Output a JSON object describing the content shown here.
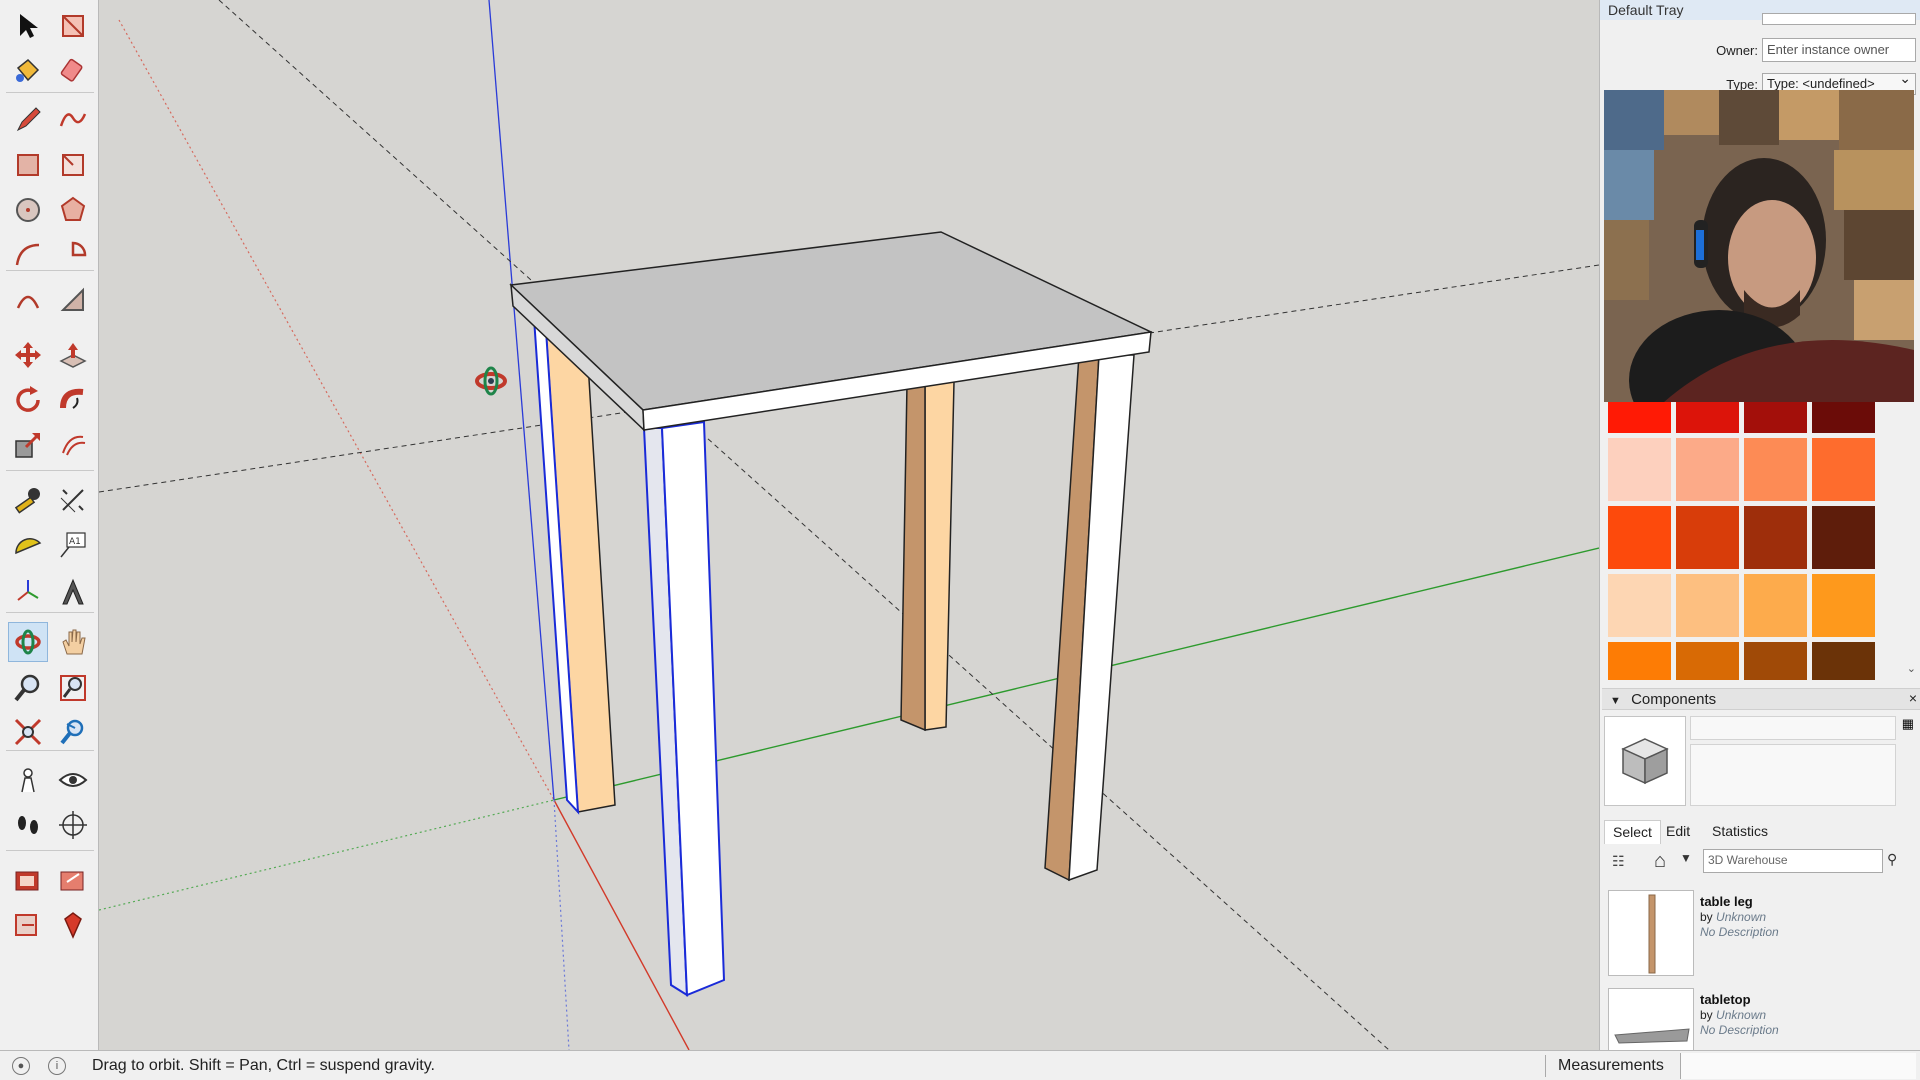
{
  "toolbar": {
    "tools": [
      {
        "name": "select-tool",
        "icon": "arrow-pointer-icon"
      },
      {
        "name": "make-component-tool",
        "icon": "component-box-icon"
      },
      {
        "name": "paint-bucket-tool",
        "icon": "paint-bucket-icon"
      },
      {
        "name": "eraser-tool",
        "icon": "eraser-icon"
      },
      {
        "name": "line-tool",
        "icon": "pencil-icon"
      },
      {
        "name": "freehand-tool",
        "icon": "freehand-squiggle-icon"
      },
      {
        "name": "rectangle-tool",
        "icon": "rectangle-icon"
      },
      {
        "name": "rotated-rectangle-tool",
        "icon": "rotated-rectangle-icon"
      },
      {
        "name": "circle-tool",
        "icon": "circle-icon"
      },
      {
        "name": "polygon-tool",
        "icon": "polygon-icon"
      },
      {
        "name": "arc-tool",
        "icon": "arc-icon"
      },
      {
        "name": "pie-tool",
        "icon": "pie-icon"
      },
      {
        "name": "three-point-arc-tool",
        "icon": "three-point-arc-icon"
      },
      {
        "name": "two-point-arc-tool",
        "icon": "two-point-arc-icon"
      },
      {
        "name": "move-tool",
        "icon": "move-arrows-icon"
      },
      {
        "name": "push-pull-tool",
        "icon": "push-pull-icon"
      },
      {
        "name": "rotate-tool",
        "icon": "rotate-icon"
      },
      {
        "name": "follow-me-tool",
        "icon": "follow-me-icon"
      },
      {
        "name": "scale-tool",
        "icon": "scale-icon"
      },
      {
        "name": "offset-tool",
        "icon": "offset-icon"
      },
      {
        "name": "tape-measure-tool",
        "icon": "tape-measure-icon"
      },
      {
        "name": "dimension-tool",
        "icon": "dimension-icon"
      },
      {
        "name": "protractor-tool",
        "icon": "protractor-icon"
      },
      {
        "name": "text-tool",
        "icon": "text-label-icon"
      },
      {
        "name": "axes-tool",
        "icon": "axes-icon"
      },
      {
        "name": "3d-text-tool",
        "icon": "3d-text-icon"
      },
      {
        "name": "orbit-tool",
        "icon": "orbit-icon"
      },
      {
        "name": "pan-tool",
        "icon": "hand-icon"
      },
      {
        "name": "zoom-tool",
        "icon": "magnifier-icon"
      },
      {
        "name": "zoom-window-tool",
        "icon": "zoom-window-icon"
      },
      {
        "name": "zoom-extents-tool",
        "icon": "zoom-extents-icon"
      },
      {
        "name": "previous-view-tool",
        "icon": "previous-view-icon"
      },
      {
        "name": "position-camera-tool",
        "icon": "position-camera-icon"
      },
      {
        "name": "look-around-tool",
        "icon": "eye-icon"
      },
      {
        "name": "walk-tool",
        "icon": "footprints-icon"
      },
      {
        "name": "section-plane-tool",
        "icon": "section-plane-icon"
      },
      {
        "name": "3d-warehouse-tool",
        "icon": "warehouse-icon"
      },
      {
        "name": "share-model-tool",
        "icon": "share-model-icon"
      },
      {
        "name": "extension-warehouse-tool",
        "icon": "extension-warehouse-icon"
      },
      {
        "name": "ruby-console-tool",
        "icon": "ruby-gem-icon"
      }
    ],
    "active_tool": "orbit-tool"
  },
  "tray": {
    "title": "Default Tray",
    "instance": {
      "owner_label": "Owner:",
      "owner_placeholder": "Enter instance owner",
      "type_label": "Type:",
      "type_value": "Type: <undefined>"
    },
    "swatches": [
      [
        "#ff1a05",
        "#dc140a",
        "#a30f0a",
        "#6b0c08"
      ],
      [
        "#fdd0be",
        "#fcaa88",
        "#fd8b55",
        "#fe6c2d"
      ],
      [
        "#fd4a0c",
        "#d83d0a",
        "#9e2e0b",
        "#5e1d0b"
      ],
      [
        "#fdd6b3",
        "#fdbf80",
        "#fdab4c",
        "#fe991c"
      ],
      [
        "#fd7c05",
        "#d86a05",
        "#a04a07",
        "#6b3308"
      ]
    ],
    "components": {
      "title": "Components",
      "tabs": [
        "Select",
        "Edit",
        "Statistics"
      ],
      "active_tab": "Select",
      "search_placeholder": "3D Warehouse",
      "items": [
        {
          "name": "table leg",
          "by_label": "by",
          "author": "Unknown",
          "description": "No Description"
        },
        {
          "name": "tabletop",
          "by_label": "by",
          "author": "Unknown",
          "description": "No Description"
        }
      ]
    }
  },
  "statusbar": {
    "hint": "Drag to orbit. Shift = Pan, Ctrl = suspend gravity.",
    "measurements_label": "Measurements"
  },
  "colors": {
    "axis_red": "#d23a2a",
    "axis_green": "#2d9a2d",
    "axis_blue": "#2a3bd8",
    "tabletop_top": "#c3c3c3",
    "leg_wood_light": "#fdd6a3",
    "leg_wood_dark": "#c4956b",
    "selection_blue": "#1a2bd8"
  }
}
